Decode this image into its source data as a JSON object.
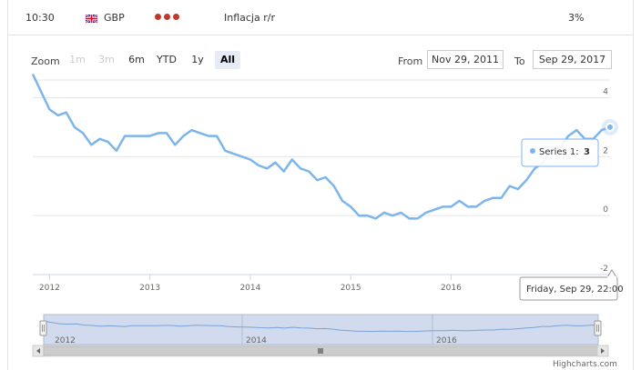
{
  "event": {
    "time": "10:30",
    "currency": "GBP",
    "name": "Inflacja r/r",
    "value": "3%",
    "importance_color": "#c0392b",
    "importance_level": 3,
    "flag_icon": "uk-flag-icon"
  },
  "range_selector": {
    "zoom_label": "Zoom",
    "buttons": [
      {
        "label": "1m",
        "state": "disabled"
      },
      {
        "label": "3m",
        "state": "disabled"
      },
      {
        "label": "6m",
        "state": "normal"
      },
      {
        "label": "YTD",
        "state": "normal"
      },
      {
        "label": "1y",
        "state": "normal"
      },
      {
        "label": "All",
        "state": "active"
      }
    ],
    "from_label": "From",
    "from_value": "Nov 29, 2011",
    "to_label": "To",
    "to_value": "Sep 29, 2017"
  },
  "tooltip": {
    "series_label": "Series 1: ",
    "series_value": "3",
    "date_label": "Friday, Sep 29, 22:00"
  },
  "credits": "Highcharts.com",
  "chart_data": {
    "type": "line",
    "series_color": "#7cb5ec",
    "x_start": "2011-11",
    "x_step": "month",
    "x_tick_labels": [
      "2012",
      "2013",
      "2014",
      "2015",
      "2016"
    ],
    "y_tick_labels": [
      "-2",
      "0",
      "2",
      "4"
    ],
    "ylim": [
      -2,
      4.6
    ],
    "values": [
      4.8,
      4.2,
      3.6,
      3.4,
      3.5,
      3.0,
      2.8,
      2.4,
      2.6,
      2.5,
      2.2,
      2.7,
      2.7,
      2.7,
      2.7,
      2.8,
      2.8,
      2.4,
      2.7,
      2.9,
      2.8,
      2.7,
      2.7,
      2.2,
      2.1,
      2.0,
      1.9,
      1.7,
      1.6,
      1.8,
      1.5,
      1.9,
      1.6,
      1.5,
      1.2,
      1.3,
      1.0,
      0.5,
      0.3,
      0.0,
      0.0,
      -0.1,
      0.1,
      0.0,
      0.1,
      -0.1,
      -0.1,
      0.1,
      0.2,
      0.3,
      0.3,
      0.5,
      0.3,
      0.3,
      0.5,
      0.6,
      0.6,
      1.0,
      0.9,
      1.2,
      1.6,
      1.8,
      2.3,
      2.3,
      2.7,
      2.9,
      2.6,
      2.6,
      2.9,
      3.0
    ],
    "navigator_x_labels": [
      "2012",
      "2014",
      "2016"
    ]
  }
}
